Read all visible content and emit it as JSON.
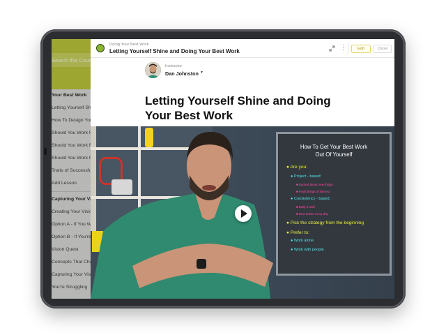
{
  "sidebar": {
    "search_placeholder": "Search this Course",
    "items": [
      {
        "label": "Your Best Work",
        "section": true
      },
      {
        "label": "Letting Yourself Shine",
        "section": false
      },
      {
        "label": "How To Design Your",
        "section": false
      },
      {
        "label": "Should You Work Fo",
        "section": false
      },
      {
        "label": "Should You Work Fo",
        "section": false
      },
      {
        "label": "Should You Work Fo",
        "section": false
      },
      {
        "label": "Traits of Successful E",
        "section": false
      },
      {
        "label": "Add Lesson",
        "section": false
      },
      {
        "label": "Capturing Your Vision",
        "section": true
      },
      {
        "label": "Creating Your Vision",
        "section": false
      },
      {
        "label": "Option A - If You Wa",
        "section": false
      },
      {
        "label": "Option B - If You're I",
        "section": false
      },
      {
        "label": "Vision Quest",
        "section": false
      },
      {
        "label": "Concepts That Cha",
        "section": false
      },
      {
        "label": "Capturing Your Visio",
        "section": false
      },
      {
        "label": "You're Struggling",
        "section": false
      }
    ]
  },
  "topbar": {
    "course_name": "Doing Your Best Work",
    "lesson_title": "Letting Yourself Shine and Doing Your Best Work",
    "edit_label": "Edit",
    "close_label": "Close",
    "expand_icon": "expand-icon",
    "more_icon": "more-vertical-icon"
  },
  "instructor": {
    "label": "Instructor",
    "name": "Dan Johnston"
  },
  "title": {
    "line1": "Letting Yourself Shine and Doing",
    "line2": "Your Best Work"
  },
  "video": {
    "play_icon": "play-icon",
    "board": {
      "title_line1": "How To Get Your Best Work",
      "title_line2": "Out Of Yourself",
      "lines": [
        {
          "text": "● Are you:",
          "color": "yellow"
        },
        {
          "text": "● Project - based:",
          "color": "cyan"
        },
        {
          "text": "■ Excited about new things",
          "color": "pink"
        },
        {
          "text": "■ Finds things of interest",
          "color": "pink"
        },
        {
          "text": "● Consistency - based:",
          "color": "cyan"
        },
        {
          "text": "■ Daily a mail",
          "color": "pink"
        },
        {
          "text": "■ New article every day",
          "color": "pink"
        },
        {
          "text": "● Pick the strategy from the beginning",
          "color": "yellow"
        },
        {
          "text": "● Prefer to:",
          "color": "yellow"
        },
        {
          "text": "● Work alone",
          "color": "cyan"
        },
        {
          "text": "● Work with people",
          "color": "cyan"
        }
      ]
    }
  },
  "colors": {
    "sidebar_accent": "#b6c234",
    "edit_accent": "#b39b0a",
    "board_yellow": "#e8ef3a",
    "board_cyan": "#4fe4e9",
    "board_pink": "#ff4aa0"
  }
}
